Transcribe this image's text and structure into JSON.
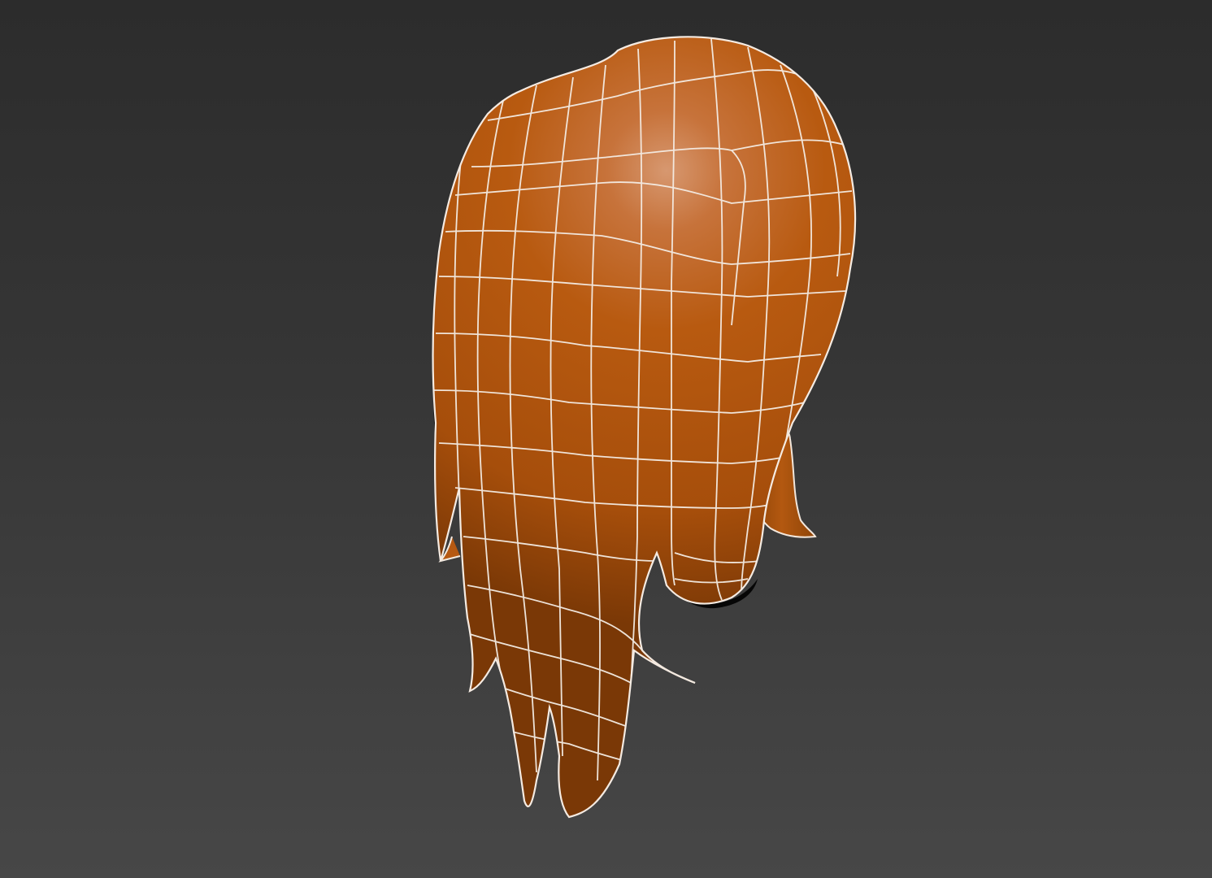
{
  "scene": {
    "object": "hair-mesh",
    "colors": {
      "background_top": "#2c2c2c",
      "background_bottom": "#474747",
      "mesh_base": "#b85a10",
      "mesh_dark": "#7a3806",
      "mesh_highlight": "#d79870",
      "wireframe": "#ffffff",
      "shadow": "#050505"
    }
  }
}
